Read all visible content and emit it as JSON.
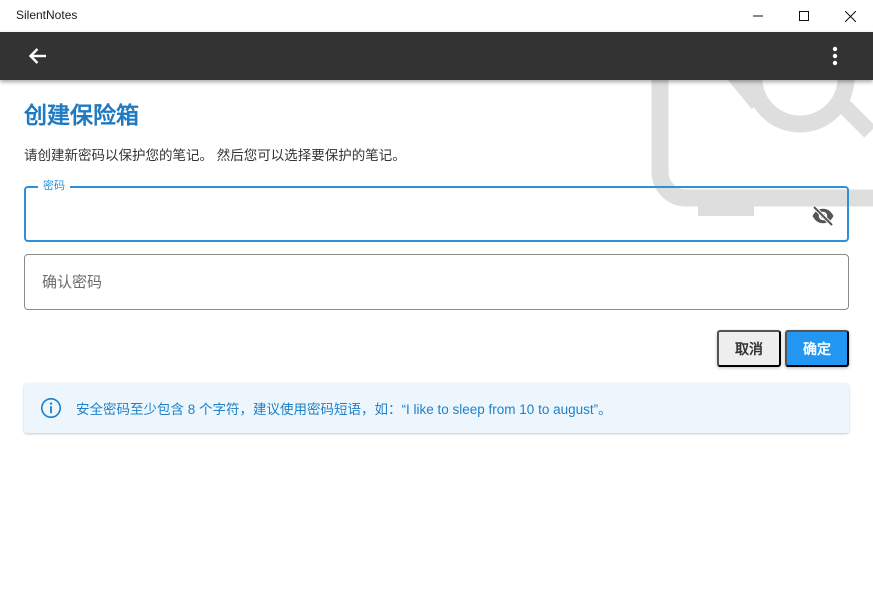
{
  "window": {
    "title": "SilentNotes"
  },
  "appbar": {
    "back_icon": "arrow-left-icon",
    "menu_icon": "more-vertical-icon"
  },
  "page": {
    "title": "创建保险箱",
    "description": "请创建新密码以保护您的笔记。 然后您可以选择要保护的笔记。"
  },
  "form": {
    "password": {
      "label": "密码",
      "value": "",
      "toggle_icon": "eye-off-icon"
    },
    "confirm_password": {
      "placeholder": "确认密码",
      "value": ""
    },
    "cancel_label": "取消",
    "ok_label": "确定"
  },
  "alert": {
    "icon": "info-icon",
    "text": "安全密码至少包含 8 个字符，建议使用密码短语，如：“I like to sleep from 10 to august”。"
  },
  "colors": {
    "accent": "#1f7ac2",
    "primary_button": "#2196f3",
    "appbar": "#333333",
    "alert_bg": "#eef6fd",
    "alert_text": "#1e80c8"
  }
}
